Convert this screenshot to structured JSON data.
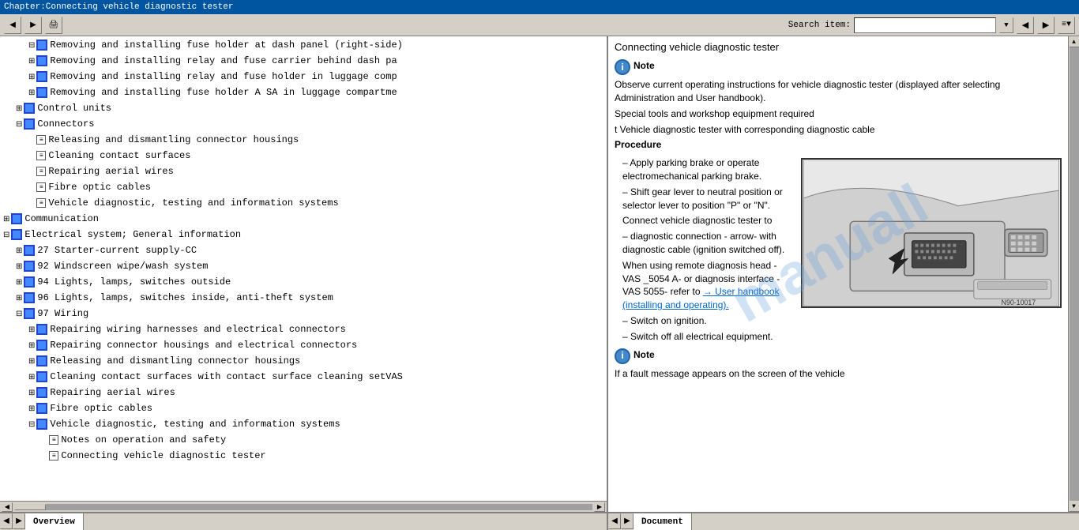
{
  "titleBar": {
    "text": "Chapter:Connecting vehicle diagnostic tester"
  },
  "toolbar": {
    "searchLabel": "Search item:",
    "searchPlaceholder": ""
  },
  "treeItems": [
    {
      "indent": 2,
      "type": "folder",
      "expanded": true,
      "text": "Removing and installing fuse holder at dash panel (right-side)",
      "level": 1
    },
    {
      "indent": 2,
      "type": "folder",
      "expanded": false,
      "text": "Removing and installing relay and fuse carrier behind dash pa",
      "level": 1
    },
    {
      "indent": 2,
      "type": "folder",
      "expanded": false,
      "text": "Removing and installing relay and fuse holder in luggage comp",
      "level": 1
    },
    {
      "indent": 2,
      "type": "folder",
      "expanded": false,
      "text": "Removing and installing fuse holder A SA in luggage compartme",
      "level": 1
    },
    {
      "indent": 1,
      "type": "folder",
      "expanded": false,
      "text": "Control units",
      "level": 0
    },
    {
      "indent": 1,
      "type": "folder",
      "expanded": true,
      "text": "Connectors",
      "level": 0
    },
    {
      "indent": 2,
      "type": "doc",
      "text": "Releasing and dismantling connector housings",
      "level": 1
    },
    {
      "indent": 2,
      "type": "doc",
      "text": "Cleaning contact surfaces",
      "level": 1
    },
    {
      "indent": 2,
      "type": "doc",
      "text": "Repairing aerial wires",
      "level": 1
    },
    {
      "indent": 2,
      "type": "doc",
      "text": "Fibre optic cables",
      "level": 1
    },
    {
      "indent": 2,
      "type": "doc",
      "text": "Vehicle diagnostic, testing and information systems",
      "level": 1
    },
    {
      "indent": 0,
      "type": "folder",
      "expanded": false,
      "text": "Communication",
      "level": 0
    },
    {
      "indent": 0,
      "type": "folder",
      "expanded": true,
      "text": "Electrical system; General information",
      "level": 0
    },
    {
      "indent": 1,
      "type": "folder",
      "expanded": false,
      "text": "27 Starter-current supply-CC",
      "level": 1
    },
    {
      "indent": 1,
      "type": "folder",
      "expanded": false,
      "text": "92 Windscreen wipe/wash system",
      "level": 1
    },
    {
      "indent": 1,
      "type": "folder",
      "expanded": false,
      "text": "94 Lights, lamps, switches outside",
      "level": 1
    },
    {
      "indent": 1,
      "type": "folder",
      "expanded": false,
      "text": "96 Lights, lamps, switches inside, anti-theft system",
      "level": 1
    },
    {
      "indent": 1,
      "type": "folder",
      "expanded": true,
      "text": "97 Wiring",
      "level": 1
    },
    {
      "indent": 2,
      "type": "folder",
      "expanded": false,
      "text": "Repairing wiring harnesses and electrical connectors",
      "level": 2
    },
    {
      "indent": 2,
      "type": "folder",
      "expanded": false,
      "text": "Repairing connector housings and electrical connectors",
      "level": 2
    },
    {
      "indent": 2,
      "type": "folder",
      "expanded": false,
      "text": "Releasing and dismantling connector housings",
      "level": 2
    },
    {
      "indent": 2,
      "type": "folder",
      "expanded": false,
      "text": "Cleaning contact surfaces with contact surface cleaning setVAS",
      "level": 2
    },
    {
      "indent": 2,
      "type": "folder",
      "expanded": false,
      "text": "Repairing aerial wires",
      "level": 2
    },
    {
      "indent": 2,
      "type": "folder",
      "expanded": false,
      "text": "Fibre optic cables",
      "level": 2
    },
    {
      "indent": 2,
      "type": "folder",
      "expanded": true,
      "text": "Vehicle diagnostic, testing and information systems",
      "level": 2
    },
    {
      "indent": 3,
      "type": "doc",
      "text": "Notes on operation and safety",
      "level": 3
    },
    {
      "indent": 3,
      "type": "doc",
      "text": "Connecting vehicle diagnostic tester",
      "level": 3
    }
  ],
  "docPanel": {
    "title": "Connecting vehicle diagnostic tester",
    "noteLabel": "Note",
    "noteText": "Observe current operating instructions for vehicle diagnostic tester (displayed after selecting Administration and User handbook).",
    "specialTools": "Special tools and workshop equipment required",
    "toolItem": "t  Vehicle diagnostic tester with corresponding diagnostic cable",
    "procedure": "Procedure",
    "steps": [
      "Apply parking brake or operate electromechanical parking brake.",
      "Shift gear lever to neutral position or selector lever to position \"P\" or \"N\".",
      "Connect vehicle diagnostic tester to diagnostic connection - arrow- with diagnostic cable (ignition switched off).",
      "When using remote diagnosis head -VAS _5054 A- or diagnosis interface -VAS 5055- refer to → User handbook (installing and operating).",
      "Switch on ignition.",
      "Switch off all electrical equipment."
    ],
    "note2Label": "Note",
    "note2Text": "If a fault message appears on the screen of the vehicle",
    "diagramLabel": "N90-10017",
    "linkText": "→ User handbook (installing and operating).",
    "connectText": "Connect vehicle diagnostic tester to diagnostic connection - arrow- with diagnostic cable (ignition switched off).",
    "arrowNote": "arrow - With diagnostic"
  },
  "tabs": {
    "left": "Overview",
    "right": "Document"
  },
  "watermark": "manu"
}
